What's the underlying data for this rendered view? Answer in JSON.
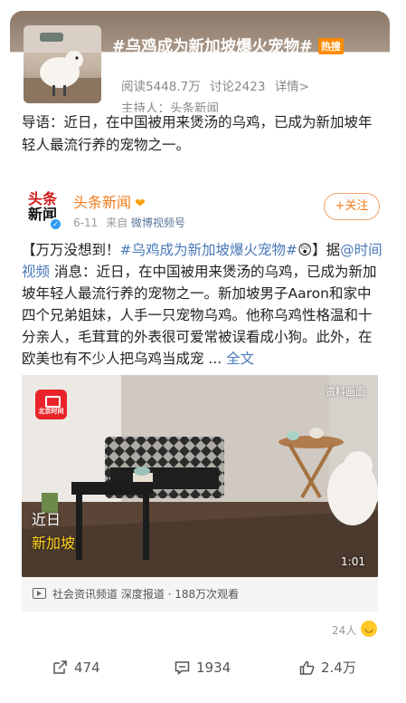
{
  "topic": {
    "title": "#乌鸡成为新加坡爆火宠物#",
    "hot_badge": "热搜",
    "reads": "阅读5448.7万",
    "discussions": "讨论2423",
    "details": "详情>",
    "host": "主持人：头条新闻"
  },
  "lead_text": "导语：近日，在中国被用来煲汤的乌鸡，已成为新加坡年轻人最流行养的宠物之一。",
  "post": {
    "author": "头条新闻",
    "avatar_line1": "头条",
    "avatar_line2": "新闻",
    "date": "6-11",
    "from_label": "来自",
    "source": "微博视频号",
    "follow_label": "+关注",
    "body_open": "【万万没想到！",
    "body_hashtag": "#乌鸡成为新加坡爆火宠物#",
    "body_mid": "😲】据",
    "body_mention": "@时间视频",
    "body_text": " 消息：近日，在中国被用来煲汤的乌鸡，已成为新加坡年轻人最流行养的宠物之一。新加坡男子Aaron和家中四个兄弟姐妹，人手一只宠物乌鸡。他称乌鸡性格温和十分亲人，毛茸茸的外表很可爱常被误看成小狗。此外，在欧美也有不少人把乌鸡当成宠 ... ",
    "full_text": "全文"
  },
  "video": {
    "badge": "北京时间",
    "top_caption": "资料画面",
    "location_line1": "近日",
    "location_line2": "新加坡",
    "duration": "1:01",
    "info": "社会资讯频道 深度报道 · 188万次观看"
  },
  "reactions": {
    "count": "24人",
    "emoji_icon": "grin-emoji-icon"
  },
  "actions": {
    "share": "474",
    "comments": "1934",
    "likes": "2.4万"
  },
  "colors": {
    "author": "#f07b1b",
    "link": "#4a79b8",
    "hot_badge": "#ff8a00"
  }
}
